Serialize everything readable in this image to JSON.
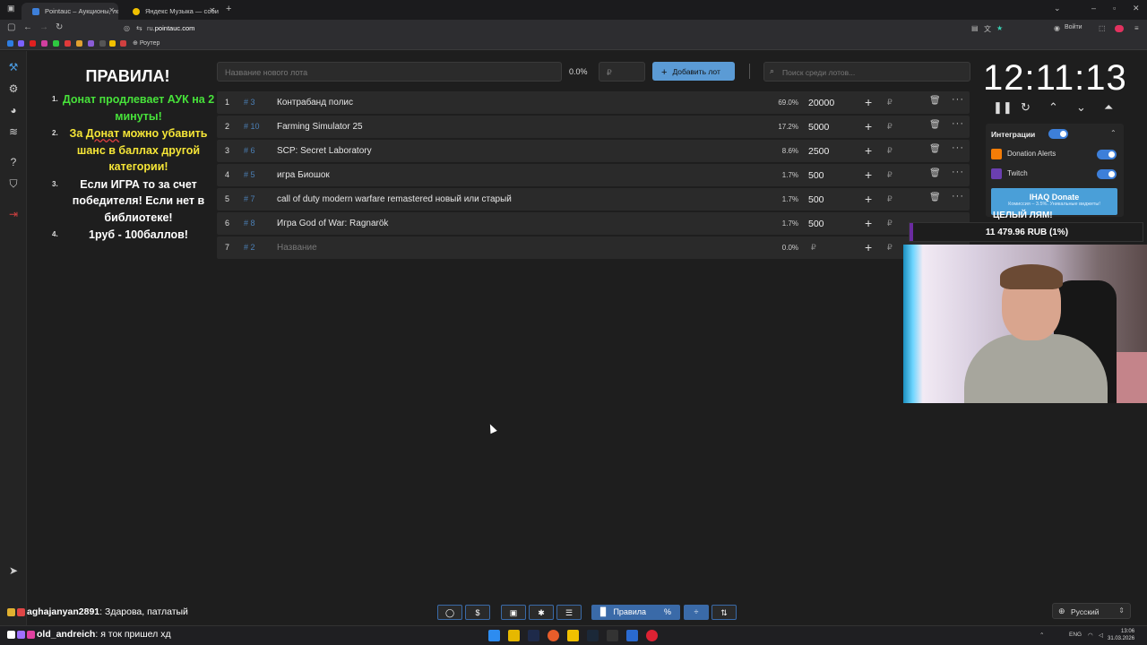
{
  "browser": {
    "tabs": [
      {
        "title": "Pointauc – Аукционы, лотереи"
      },
      {
        "title": "Яндекс Музыка — собира"
      }
    ],
    "url_prefix": "ru.",
    "url_domain": "pointauc.com",
    "bookmark_router": "Роутер",
    "login_label": "Войти"
  },
  "rules": {
    "title": "ПРАВИЛА!",
    "items": [
      {
        "num": "1.",
        "text": "Донат продлевает АУК на 2 минуты!"
      },
      {
        "num": "2.",
        "pre": "За ",
        "highlight": "Донат",
        "post": " можно убавить шанс в баллах другой категории!"
      },
      {
        "num": "3.",
        "text": "Если ИГРА то за счет победителя! Если нет в библиотеке!"
      },
      {
        "num": "4.",
        "text": "1руб - 100баллов!"
      }
    ]
  },
  "toolbar": {
    "lot_name_placeholder": "Название нового лота",
    "percent": "0.0%",
    "currency_placeholder": "₽",
    "add_lot_label": "Добавить лот",
    "search_placeholder": "Поиск среди лотов..."
  },
  "lots": [
    {
      "index": "1",
      "id": "# 3",
      "name": "Контрабанд полис",
      "percent": "69.0%",
      "amount": "20000"
    },
    {
      "index": "2",
      "id": "# 10",
      "name": "Farming Simulator 25",
      "percent": "17.2%",
      "amount": "5000"
    },
    {
      "index": "3",
      "id": "# 6",
      "name": "SCP: Secret Laboratory",
      "percent": "8.6%",
      "amount": "2500"
    },
    {
      "index": "4",
      "id": "# 5",
      "name": "игра Биошок",
      "percent": "1.7%",
      "amount": "500"
    },
    {
      "index": "5",
      "id": "# 7",
      "name": "call of duty modern warfare remastered новый  или старый",
      "percent": "1.7%",
      "amount": "500"
    },
    {
      "index": "6",
      "id": "# 8",
      "name": "Игра God of War: Ragnarök",
      "percent": "1.7%",
      "amount": "500"
    },
    {
      "index": "7",
      "id": "# 2",
      "name": "Название",
      "percent": "0.0%",
      "amount": "₽"
    }
  ],
  "lot_currency": "₽",
  "timer": {
    "time": "12:11:13"
  },
  "integrations": {
    "title": "Интеграции",
    "items": [
      {
        "label": "Donation Alerts",
        "enabled": true
      },
      {
        "label": "Twitch",
        "enabled": true
      }
    ],
    "iq_title": "IHAQ Donate",
    "iq_subtitle": "Комиссия – 3.5%. Уникальные виджеты!"
  },
  "overlay": {
    "goal_title": "ЦЕЛЫЙ ЛЯМ!",
    "goal_progress": "11 479.96 RUB (1%)",
    "goal_fraction": 0.01
  },
  "bottom_toolbar": {
    "rules_label": "Правила",
    "language": "Русский"
  },
  "chat": [
    {
      "nick": "aghajanyan2891",
      "message": ": Здарова, патлатый"
    },
    {
      "nick": "old_andreich",
      "message": ": я ток пришел хд"
    }
  ],
  "taskbar": {
    "lang": "ENG",
    "time": "13:06",
    "date": "31.03.2026"
  },
  "colors": {
    "accent": "#5b9bd5",
    "rule_green": "#47e23a",
    "rule_yellow": "#f5e537",
    "lot_hash": "#4b7fb5",
    "toggle": "#3d7fd9"
  }
}
